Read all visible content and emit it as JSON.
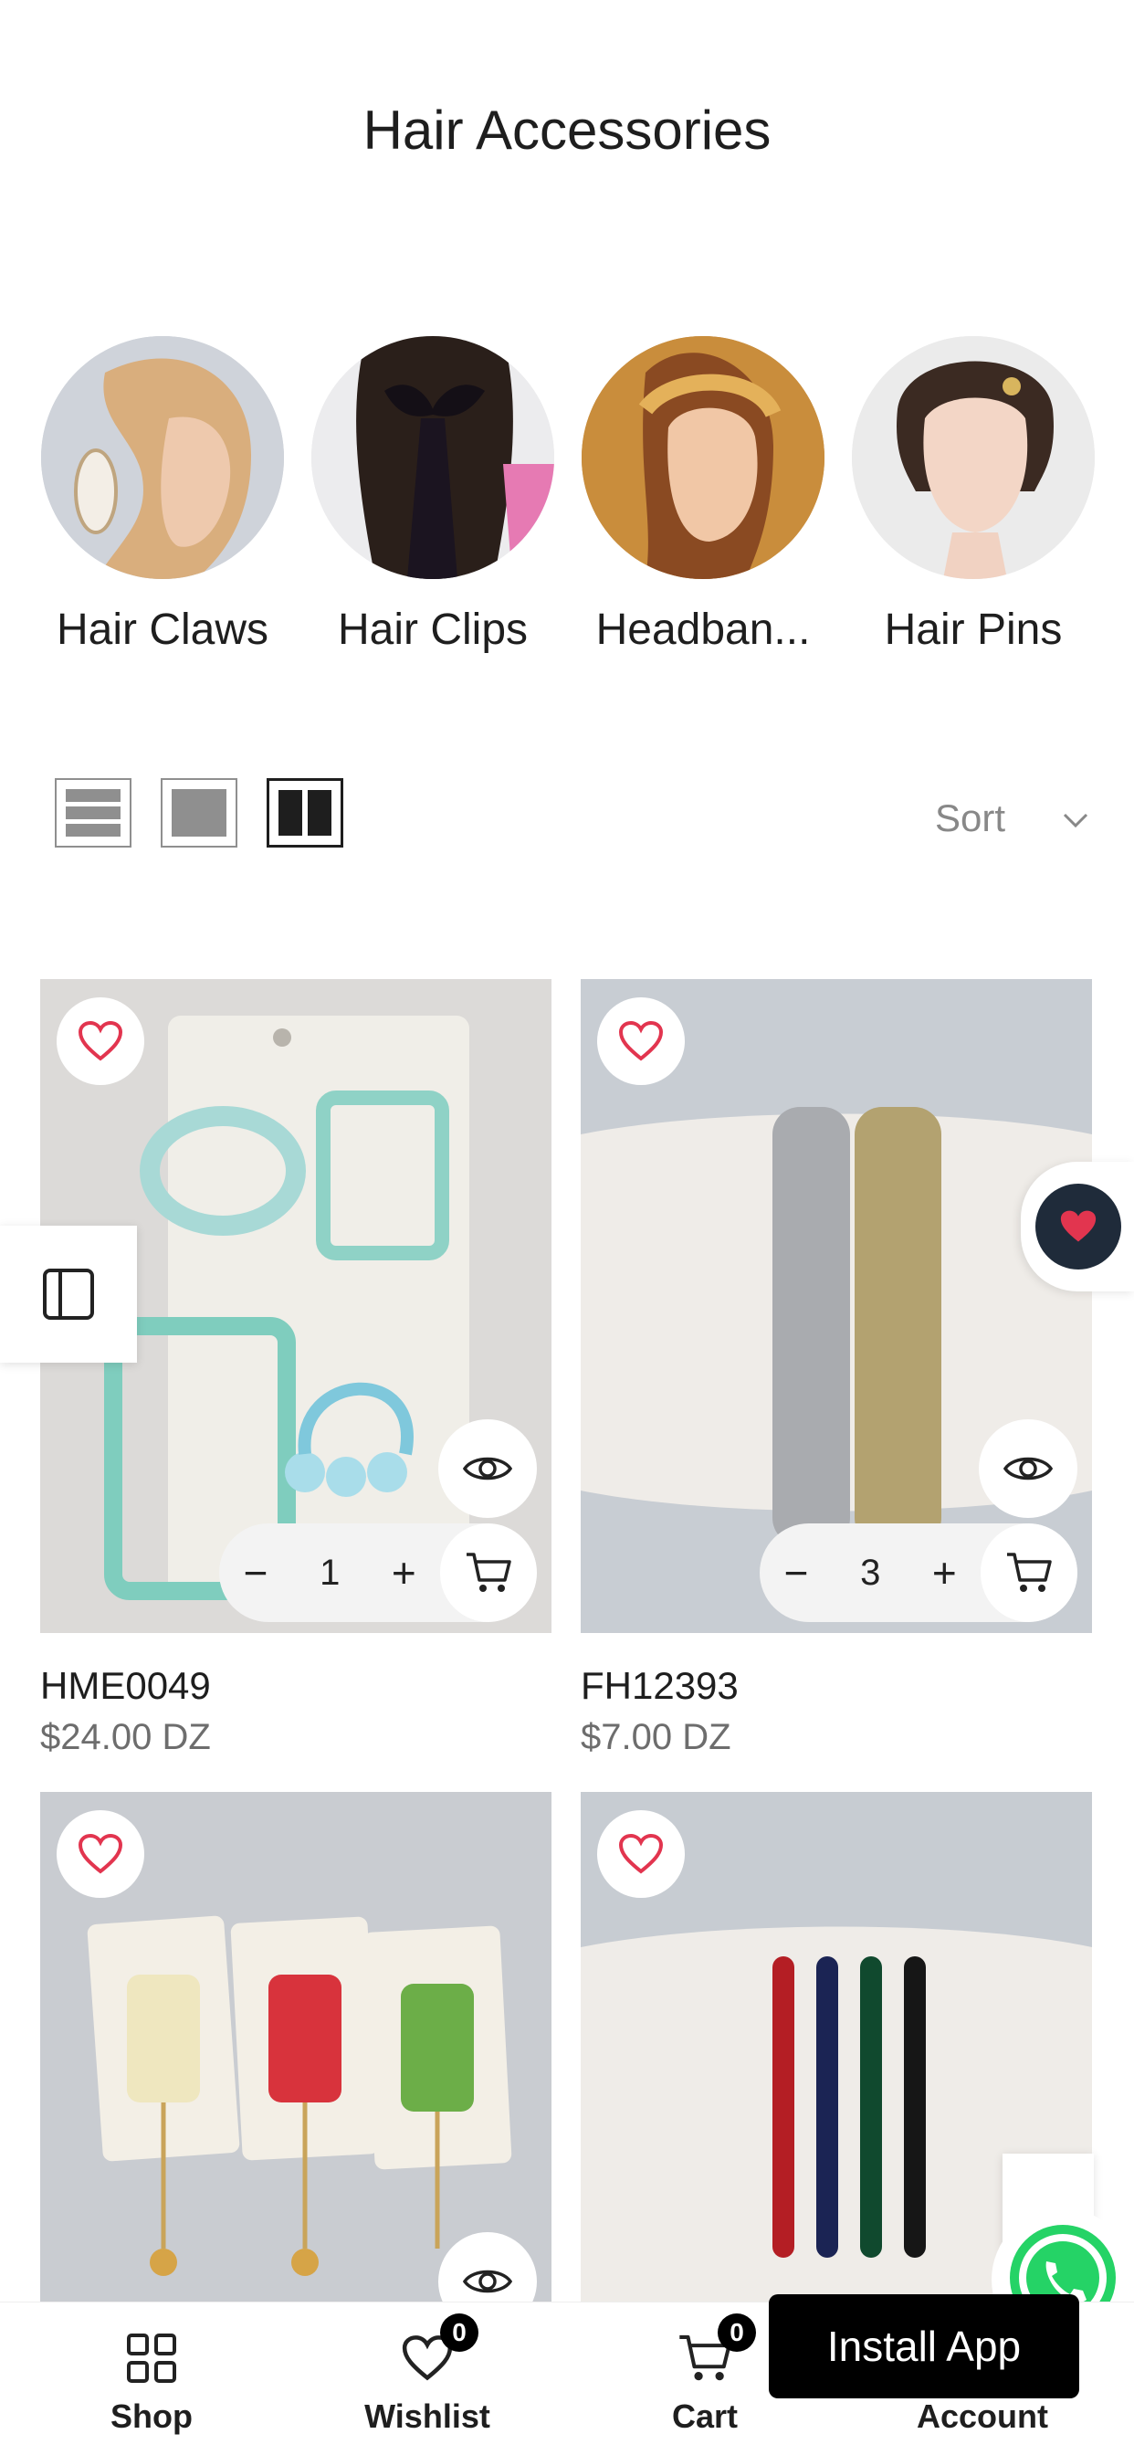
{
  "page": {
    "title": "Hair Accessories"
  },
  "categories": [
    {
      "label": "Hair Claws"
    },
    {
      "label": "Hair Clips"
    },
    {
      "label": "Headban..."
    },
    {
      "label": "Hair Pins"
    }
  ],
  "toolbar": {
    "sort_label": "Sort",
    "active_view": "grid-2"
  },
  "products": [
    {
      "name": "HME0049",
      "price": "$24.00 DZ",
      "qty": "1"
    },
    {
      "name": "FH12393",
      "price": "$7.00 DZ",
      "qty": "3"
    },
    {
      "name": "",
      "price": "",
      "qty": ""
    },
    {
      "name": "",
      "price": "",
      "qty": ""
    }
  ],
  "bottom_nav": {
    "shop": "Shop",
    "wishlist": "Wishlist",
    "wishlist_count": "0",
    "cart": "Cart",
    "cart_count": "0",
    "account": "Account"
  },
  "install_app": "Install App",
  "colors": {
    "heart": "#e2354f",
    "fav_dark": "#1f2b3a",
    "whatsapp": "#25d366"
  }
}
